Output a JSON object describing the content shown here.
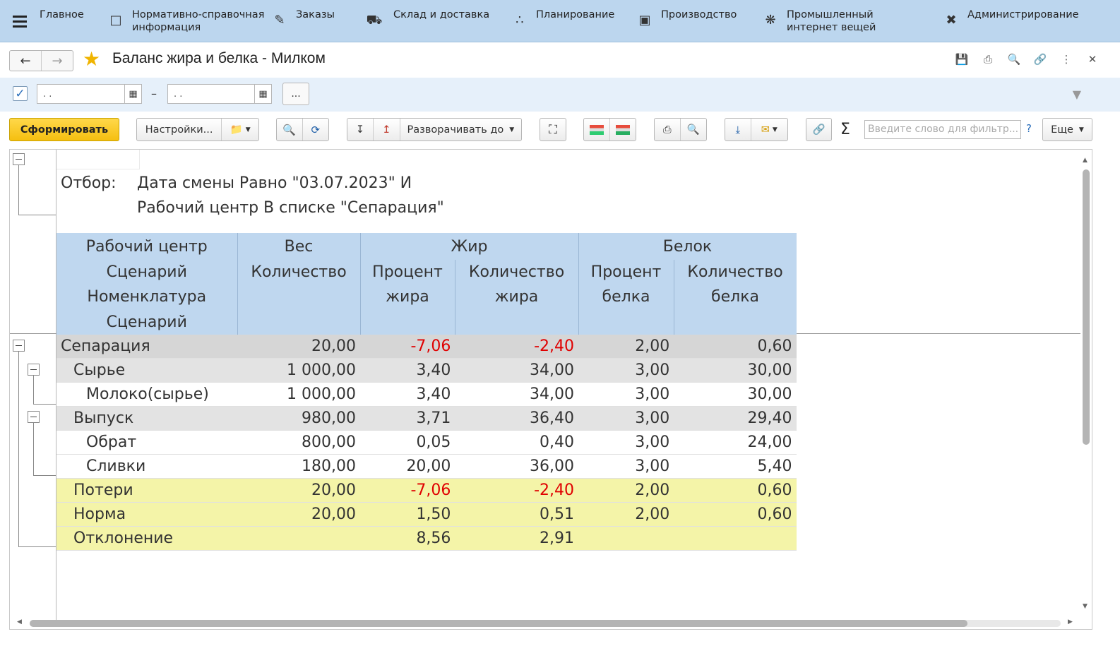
{
  "nav": {
    "items": [
      {
        "label": "Главное",
        "icon": "menu-icon"
      },
      {
        "label": "Нормативно-справочная информация",
        "icon": "reference-book-icon"
      },
      {
        "label": "Заказы",
        "icon": "orders-icon"
      },
      {
        "label": "Склад и доставка",
        "icon": "truck-icon"
      },
      {
        "label": "Планирование",
        "icon": "planning-icon"
      },
      {
        "label": "Производство",
        "icon": "factory-icon"
      },
      {
        "label": "Промышленный интернет вещей",
        "icon": "iot-icon"
      },
      {
        "label": "Администрирование",
        "icon": "tools-icon"
      }
    ]
  },
  "window": {
    "title": "Баланс жира и белка - Милком"
  },
  "period": {
    "from_value": ". .",
    "to_value": ". .",
    "dash": "–",
    "more_label": "..."
  },
  "toolbar": {
    "generate_label": "Сформировать",
    "settings_label": "Настройки...",
    "expand_label": "Разворачивать до",
    "search_placeholder": "Введите слово для фильтр...",
    "help_label": "?",
    "more_label": "Еще",
    "sigma_label": "Σ"
  },
  "report": {
    "filter_label": "Отбор:",
    "filter_line1": "Дата смены Равно \"03.07.2023\" И",
    "filter_line2": "Рабочий центр В списке \"Сепарация\"",
    "headers": {
      "col1": [
        "Рабочий центр",
        "Сценарий",
        "Номенклатура",
        "Сценарий"
      ],
      "weight_group": "Вес",
      "weight_qty": "Количество",
      "fat_group": "Жир",
      "fat_pct": [
        "Процент",
        "жира"
      ],
      "fat_qty": [
        "Количество",
        "жира"
      ],
      "protein_group": "Белок",
      "protein_pct": [
        "Процент",
        "белка"
      ],
      "protein_qty": [
        "Количество",
        "белка"
      ]
    },
    "rows": [
      {
        "name": "Сепарация",
        "weight": "20,00",
        "fat_pct": "-7,06",
        "fat_qty": "-2,40",
        "prot_pct": "2,00",
        "prot_qty": "0,60"
      },
      {
        "name": "Сырье",
        "weight": "1 000,00",
        "fat_pct": "3,40",
        "fat_qty": "34,00",
        "prot_pct": "3,00",
        "prot_qty": "30,00"
      },
      {
        "name": "Молоко(сырье)",
        "weight": "1 000,00",
        "fat_pct": "3,40",
        "fat_qty": "34,00",
        "prot_pct": "3,00",
        "prot_qty": "30,00"
      },
      {
        "name": "Выпуск",
        "weight": "980,00",
        "fat_pct": "3,71",
        "fat_qty": "36,40",
        "prot_pct": "3,00",
        "prot_qty": "29,40"
      },
      {
        "name": "Обрат",
        "weight": "800,00",
        "fat_pct": "0,05",
        "fat_qty": "0,40",
        "prot_pct": "3,00",
        "prot_qty": "24,00"
      },
      {
        "name": "Сливки",
        "weight": "180,00",
        "fat_pct": "20,00",
        "fat_qty": "36,00",
        "prot_pct": "3,00",
        "prot_qty": "5,40"
      },
      {
        "name": "Потери",
        "weight": "20,00",
        "fat_pct": "-7,06",
        "fat_qty": "-2,40",
        "prot_pct": "2,00",
        "prot_qty": "0,60"
      },
      {
        "name": "Норма",
        "weight": "20,00",
        "fat_pct": "1,50",
        "fat_qty": "0,51",
        "prot_pct": "2,00",
        "prot_qty": "0,60"
      },
      {
        "name": "Отклонение",
        "weight": "",
        "fat_pct": "8,56",
        "fat_qty": "2,91",
        "prot_pct": "",
        "prot_qty": ""
      }
    ]
  },
  "colors": {
    "nav_bg": "#bcd6ee",
    "header_bg": "#bfd7ef",
    "group_bg": "#d6d6d6",
    "highlight_bg": "#f4f4a8",
    "negative": "#e00000",
    "primary_button": "#f5bf10"
  }
}
